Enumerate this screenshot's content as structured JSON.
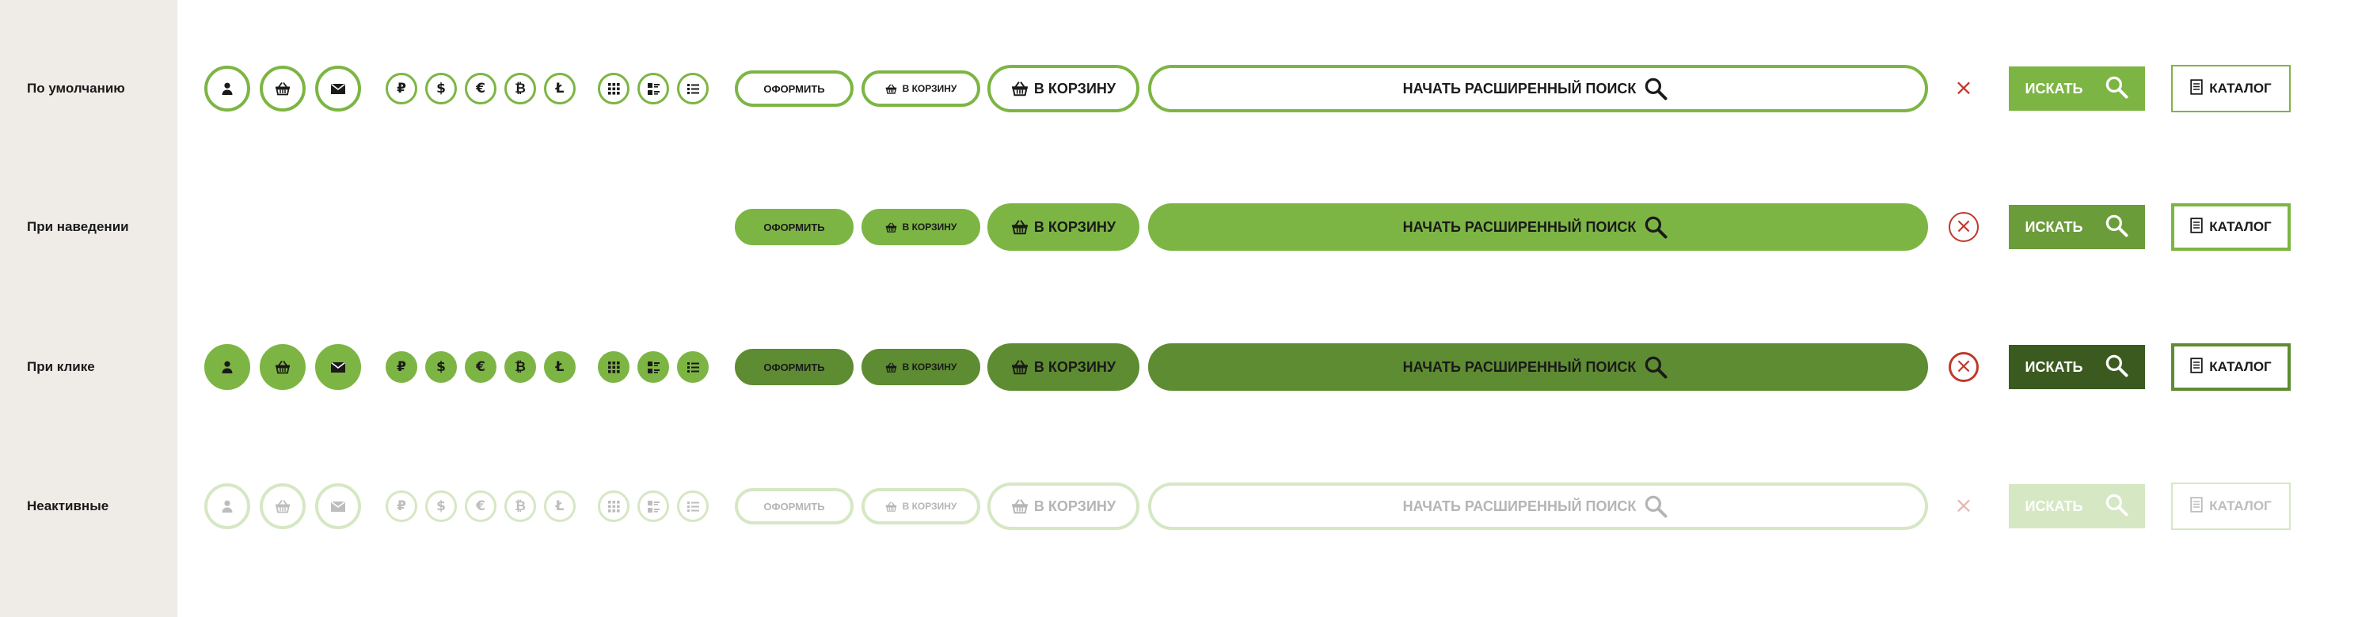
{
  "colors": {
    "sidebar_bg": "#efece8",
    "green": "#7db544",
    "green_hover": "#6b9c3a",
    "green_dark": "#5e8c32",
    "green_deep": "#3b5a20",
    "disabled": "#d6e7c4",
    "close_red": "#c0392b"
  },
  "rows": [
    {
      "label": "По умолчанию"
    },
    {
      "label": "При наведении"
    },
    {
      "label": "При клике"
    },
    {
      "label": "Неактивные"
    }
  ],
  "icons": {
    "circle": [
      "user-icon",
      "basket-icon",
      "mail-icon"
    ],
    "currency": [
      "₽",
      "$",
      "€",
      "₿",
      "Ł"
    ],
    "view": [
      "grid-view-icon",
      "tile-list-view-icon",
      "list-view-icon"
    ]
  },
  "buttons": {
    "checkout": "ОФОРМИТЬ",
    "to_cart_small": "В КОРЗИНУ",
    "to_cart_large": "В КОРЗИНУ",
    "advanced_search": "НАЧАТЬ РАСШИРЕННЫЙ ПОИСК",
    "search": "ИСКАТЬ",
    "catalog": "КАТАЛОГ",
    "close": "×"
  }
}
